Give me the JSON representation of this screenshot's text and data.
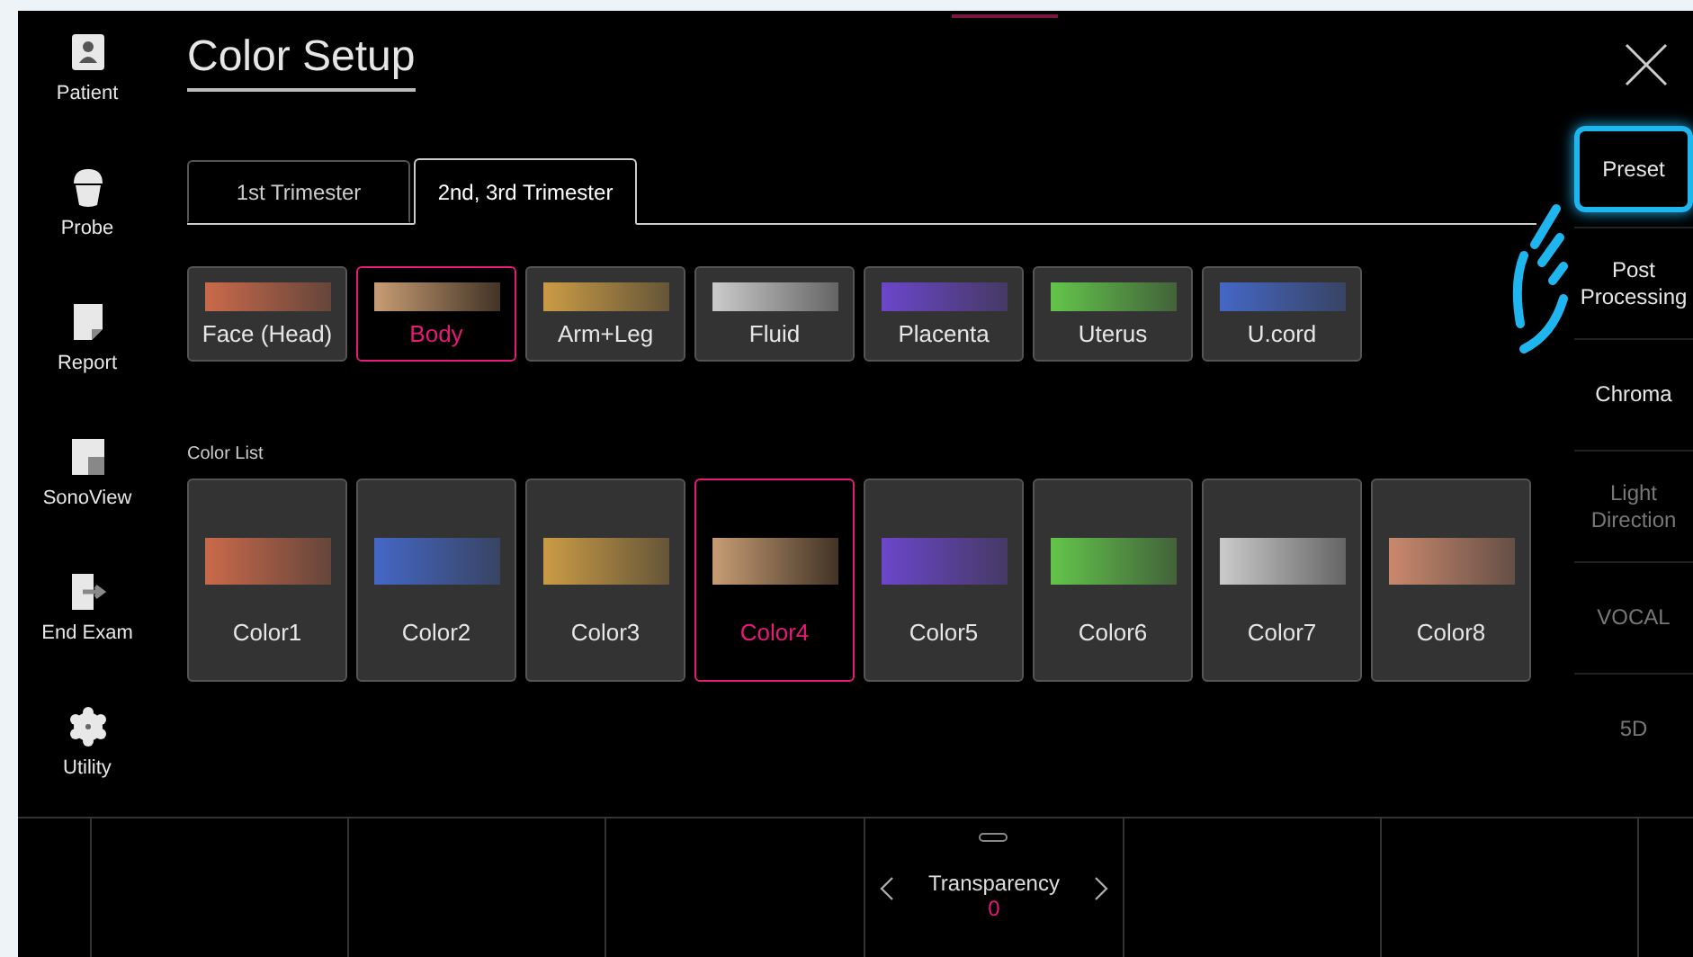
{
  "sidebar": {
    "items": [
      {
        "label": "Patient",
        "kind": "patient"
      },
      {
        "label": "Probe",
        "kind": "probe"
      },
      {
        "label": "Report",
        "kind": "report"
      },
      {
        "label": "SonoView",
        "kind": "sonoview"
      },
      {
        "label": "End Exam",
        "kind": "endexam"
      },
      {
        "label": "Utility",
        "kind": "utility"
      }
    ]
  },
  "title": "Color Setup",
  "tabs": [
    {
      "label": "1st Trimester",
      "selected": false
    },
    {
      "label": "2nd, 3rd Trimester",
      "selected": true
    }
  ],
  "parts": [
    {
      "label": "Face (Head)",
      "color": "#c8694a",
      "selected": false
    },
    {
      "label": "Body",
      "color": "#c49a72",
      "selected": true
    },
    {
      "label": "Arm+Leg",
      "color": "#c99a45",
      "selected": false
    },
    {
      "label": "Fluid",
      "color": "#c8c8c8",
      "selected": false
    },
    {
      "label": "Placenta",
      "color": "#6a46c8",
      "selected": false
    },
    {
      "label": "Uterus",
      "color": "#62c24a",
      "selected": false
    },
    {
      "label": "U.cord",
      "color": "#4466c4",
      "selected": false
    }
  ],
  "color_list": {
    "label": "Color List",
    "items": [
      {
        "label": "Color1",
        "color": "#c8694a",
        "selected": false
      },
      {
        "label": "Color2",
        "color": "#4466c4",
        "selected": false
      },
      {
        "label": "Color3",
        "color": "#c99a45",
        "selected": false
      },
      {
        "label": "Color4",
        "color": "#c49a72",
        "selected": true
      },
      {
        "label": "Color5",
        "color": "#6a46c8",
        "selected": false
      },
      {
        "label": "Color6",
        "color": "#62c24a",
        "selected": false
      },
      {
        "label": "Color7",
        "color": "#c8c8c8",
        "selected": false
      },
      {
        "label": "Color8",
        "color": "#c8876c",
        "selected": false
      }
    ]
  },
  "right_menu": [
    {
      "label": "Preset",
      "selected": true,
      "disabled": false
    },
    {
      "label": "Post Processing",
      "selected": false,
      "disabled": false
    },
    {
      "label": "Chroma",
      "selected": false,
      "disabled": false
    },
    {
      "label": "Light Direction",
      "selected": false,
      "disabled": true
    },
    {
      "label": "VOCAL",
      "selected": false,
      "disabled": true
    },
    {
      "label": "5D",
      "selected": false,
      "disabled": true
    }
  ],
  "bottom_bar": {
    "control": {
      "label": "Transparency",
      "value": "0"
    }
  }
}
